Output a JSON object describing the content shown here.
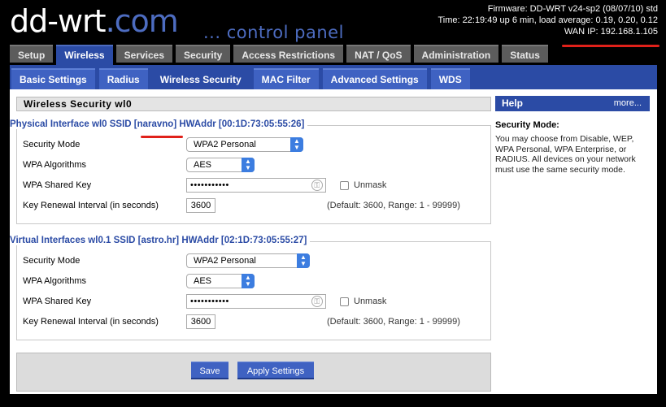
{
  "header": {
    "logo_main": "dd-wrt",
    "logo_dot": ".",
    "logo_domain": "com",
    "tagline": "... control panel",
    "firmware": "Firmware: DD-WRT v24-sp2 (08/07/10) std",
    "time": "Time: 22:19:49 up 6 min, load average: 0.19, 0.20, 0.12",
    "wan_ip": "WAN IP: 192.168.1.105"
  },
  "tabs": [
    "Setup",
    "Wireless",
    "Services",
    "Security",
    "Access Restrictions",
    "NAT / QoS",
    "Administration",
    "Status"
  ],
  "subtabs": [
    "Basic Settings",
    "Radius",
    "Wireless Security",
    "MAC Filter",
    "Advanced Settings",
    "WDS"
  ],
  "section_title": "Wireless Security wl0",
  "physical": {
    "legend": "Physical Interface wl0 SSID [naravno] HWAddr [00:1D:73:05:55:26]",
    "security_mode_label": "Security Mode",
    "security_mode_value": "WPA2 Personal",
    "wpa_alg_label": "WPA Algorithms",
    "wpa_alg_value": "AES",
    "shared_key_label": "WPA Shared Key",
    "shared_key_value": "•••••••••••",
    "unmask_label": "Unmask",
    "renewal_label": "Key Renewal Interval (in seconds)",
    "renewal_value": "3600",
    "renewal_hint": "(Default: 3600, Range: 1 - 99999)"
  },
  "virtual": {
    "legend": "Virtual Interfaces wl0.1 SSID [astro.hr] HWAddr [02:1D:73:05:55:27]",
    "security_mode_label": "Security Mode",
    "security_mode_value": "WPA2 Personal",
    "wpa_alg_label": "WPA Algorithms",
    "wpa_alg_value": "AES",
    "shared_key_label": "WPA Shared Key",
    "shared_key_value": "•••••••••••",
    "unmask_label": "Unmask",
    "renewal_label": "Key Renewal Interval (in seconds)",
    "renewal_value": "3600",
    "renewal_hint": "(Default: 3600, Range: 1 - 99999)"
  },
  "buttons": {
    "save": "Save",
    "apply": "Apply Settings"
  },
  "help": {
    "title": "Help",
    "more": "more...",
    "heading": "Security Mode:",
    "text": "You may choose from Disable, WEP, WPA Personal, WPA Enterprise, or RADIUS. All devices on your network must use the same security mode."
  },
  "colors": {
    "accent": "#2b4ba5",
    "annotation_red": "#e0211a"
  }
}
